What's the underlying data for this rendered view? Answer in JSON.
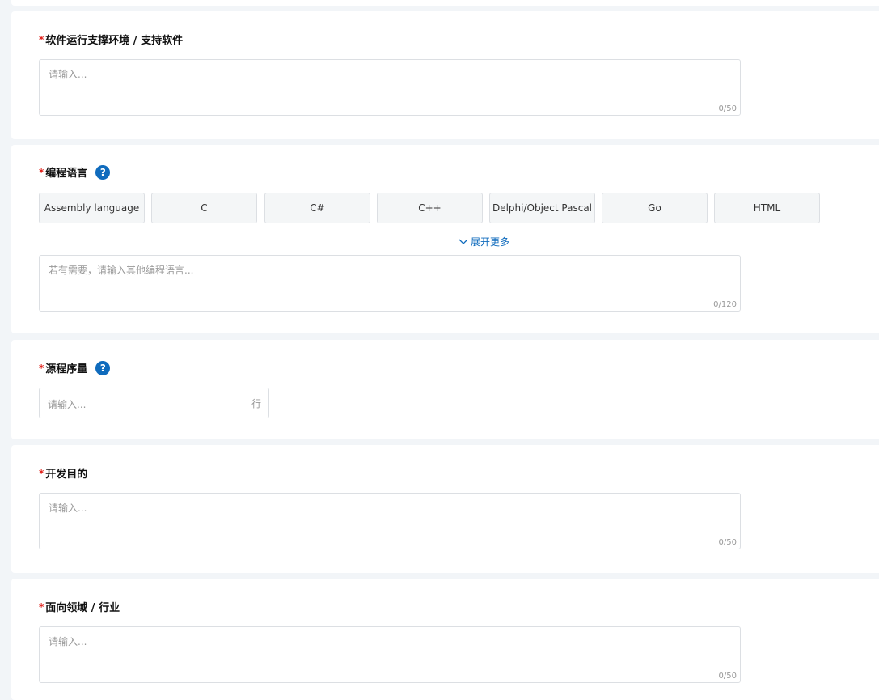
{
  "sections": [
    {
      "label": "软件运行支撑环境 / 支持软件",
      "placeholder": "请输入...",
      "count": "0/50"
    },
    {
      "label": "编程语言",
      "chips": [
        "Assembly language",
        "C",
        "C#",
        "C++",
        "Delphi/Object Pascal",
        "Go",
        "HTML"
      ],
      "expand": "展开更多",
      "placeholder": "若有需要，请输入其他编程语言...",
      "count": "0/120"
    },
    {
      "label": "源程序量",
      "placeholder": "请输入...",
      "suffix": "行"
    },
    {
      "label": "开发目的",
      "placeholder": "请输入...",
      "count": "0/50"
    },
    {
      "label": "面向领域 / 行业",
      "placeholder": "请输入...",
      "count": "0/50"
    }
  ],
  "required_mark": "*",
  "help_glyph": "?"
}
